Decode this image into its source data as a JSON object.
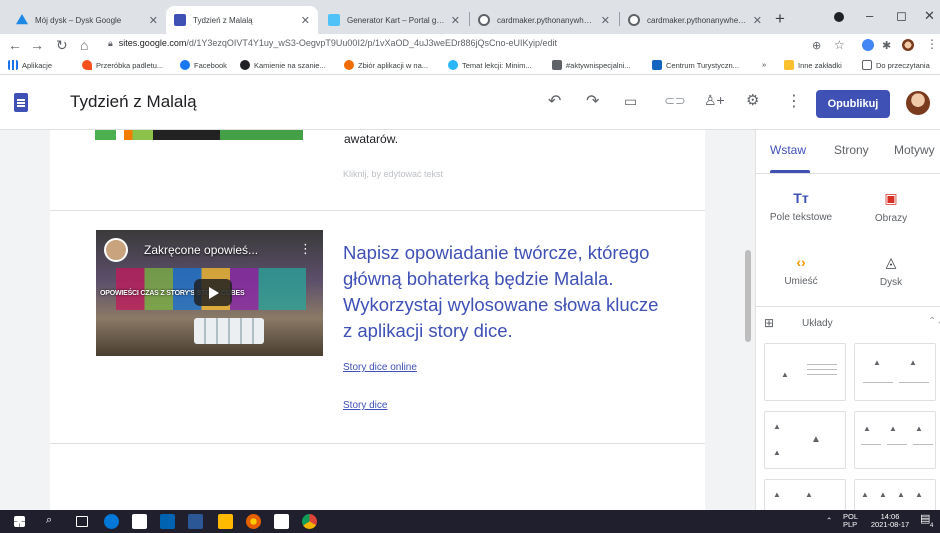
{
  "browser": {
    "tabs": [
      {
        "title": "Mój dysk – Dysk Google",
        "favicon_color": "#1e88e5",
        "active": false
      },
      {
        "title": "Tydzień z Malalą",
        "favicon_color": "#3f51b5",
        "active": true
      },
      {
        "title": "Generator Kart – Portal gier p",
        "favicon_color": "#4fc3f7",
        "active": false
      },
      {
        "title": "cardmaker.pythonanywhere.",
        "favicon_color": "#5f6368",
        "active": false
      },
      {
        "title": "cardmaker.pythonanywhere.",
        "favicon_color": "#5f6368",
        "active": false
      }
    ],
    "new_tab": "+",
    "window_controls": {
      "minimize": "–",
      "maximize": "◻",
      "close": "✕"
    },
    "address": {
      "host": "sites.google.com",
      "path": "/d/1Y3ezqOIVT4Y1uy_wS3-OegvpT9Uu00I2/p/1vXaOD_4uJ3weEDr886jQsCno-eUIKyip/edit"
    },
    "bookmarks": [
      {
        "label": "Aplikacje",
        "color": "#1a73e8"
      },
      {
        "label": "Przeróbka padletu...",
        "color": "#f4511e"
      },
      {
        "label": "Facebook",
        "color": "#1877f2"
      },
      {
        "label": "Kamienie na szanie...",
        "color": "#202124"
      },
      {
        "label": "Zbiór aplikacji w na...",
        "color": "#ef6c00"
      },
      {
        "label": "Temat lekcji: Minim...",
        "color": "#29b6f6"
      },
      {
        "label": "#aktywnispecjalni...",
        "color": "#5f6368"
      },
      {
        "label": "Centrum Turystyczn...",
        "color": "#1565c0"
      },
      {
        "label": "»",
        "color": ""
      },
      {
        "label": "Inne zakładki",
        "color": "#fbc02d"
      },
      {
        "label": "Do przeczytania",
        "color": "#5f6368"
      }
    ]
  },
  "editor": {
    "doc_title": "Tydzień z Malalą",
    "publish_label": "Opublikuj",
    "accent": "#3f51b5"
  },
  "content": {
    "section1": {
      "text_tail": "awatarów.",
      "edit_hint": "Kliknij, by edytować tekst"
    },
    "section2": {
      "video": {
        "title": "Zakręcone opowieś...",
        "overlay_text": "OPOWIEŚCI CZAS Z STORY'S STORY CUBES"
      },
      "headline": "Napisz opowiadanie twórcze, którego główną bohaterką będzie Malala. Wykorzystaj wylosowane słowa klucze z aplikacji story dice.",
      "links": [
        "Story dice online",
        "Story dice"
      ]
    }
  },
  "panel": {
    "tabs": [
      "Wstaw",
      "Strony",
      "Motywy"
    ],
    "active_tab": "Wstaw",
    "insert_items": [
      {
        "label": "Pole tekstowe",
        "icon": "text-box-icon",
        "glyph": "Tт",
        "color": "#3f51b5"
      },
      {
        "label": "Obrazy",
        "icon": "image-icon",
        "glyph": "▣",
        "color": "#d93025"
      },
      {
        "label": "Umieść",
        "icon": "embed-icon",
        "glyph": "‹›",
        "color": "#f29900"
      },
      {
        "label": "Dysk",
        "icon": "drive-icon",
        "glyph": "◬",
        "color": "#3c4043"
      }
    ],
    "layouts_label": "Układy"
  },
  "taskbar": {
    "language": "POL",
    "layout": "PLP",
    "time": "14:06",
    "date": "2021-08-17",
    "notifications": "4"
  }
}
